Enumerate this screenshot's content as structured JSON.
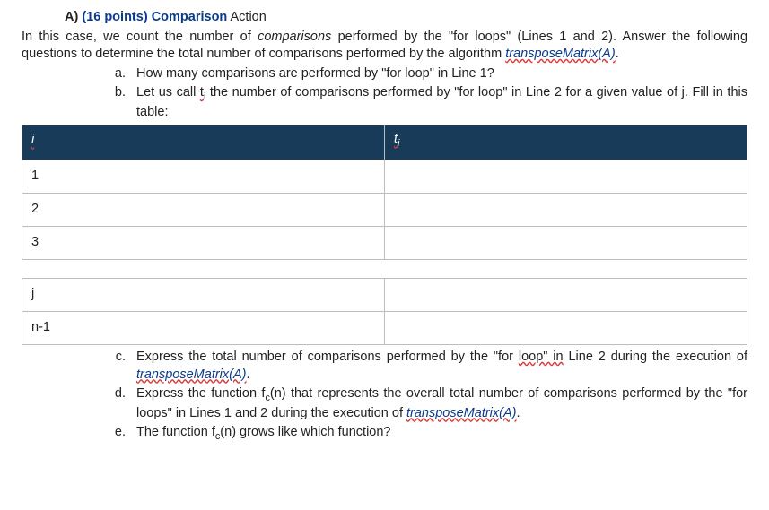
{
  "header": {
    "label": "A)",
    "points": "(16 points)",
    "topic": "Comparison",
    "trail": " Action"
  },
  "intro": {
    "part1": "In this case, we count the number of ",
    "comparisons_italic": "comparisons",
    "part2": " performed by the \"for loops\" (Lines 1 and 2). Answer the following questions to determine the total number of comparisons performed by the algorithm ",
    "func": "transposeMatrix(A)",
    "end": "."
  },
  "items_ab": {
    "a": "How many comparisons are performed by \"for loop\" in Line 1?",
    "b_part1": "Let us call ",
    "b_ti": "t",
    "b_part2": " the number of comparisons performed by \"for loop\" in Line 2 for a given value of j. Fill in this table:"
  },
  "table": {
    "header_left": "i",
    "header_right": "ti",
    "rows": [
      {
        "left": "1",
        "right": ""
      },
      {
        "left": "2",
        "right": ""
      },
      {
        "left": "3",
        "right": ""
      }
    ],
    "rows2": [
      {
        "left": "j",
        "right": ""
      },
      {
        "left": "n-1",
        "right": ""
      }
    ]
  },
  "items_cde": {
    "c_part1": "Express the total number of comparisons performed by the \"for ",
    "c_loopin": "loop\"  in",
    "c_part2": " Line 2 during the execution of ",
    "c_func": "transposeMatrix(A)",
    "c_end": ".",
    "d_part1": "Express the function f",
    "d_sub": "c",
    "d_part2": "(n) that represents the overall total number of comparisons performed by the \"for loops\" in Lines 1 and 2 during the execution of ",
    "d_func": "transposeMatrix(A)",
    "d_end": ".",
    "e_part1": "The function f",
    "e_sub": "c",
    "e_part2": "(n) grows like which function?"
  }
}
